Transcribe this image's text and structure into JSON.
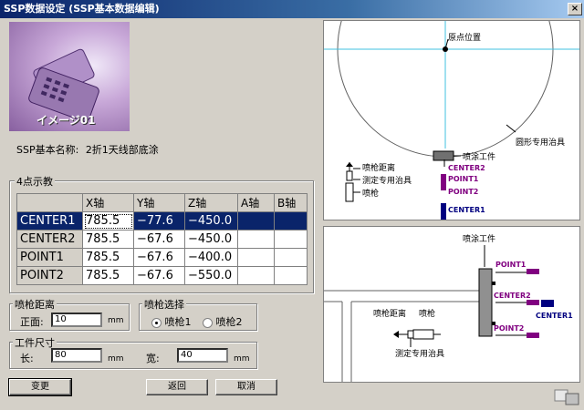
{
  "window": {
    "title": "SSP数据设定 (SSP基本数据编辑)",
    "close_glyph": "×"
  },
  "photo": {
    "label": "イメージ01"
  },
  "ssp_name": {
    "label": "SSP基本名称:",
    "value": "2折1天线部底涂"
  },
  "points_group": {
    "title": "4点示教",
    "columns": [
      "X轴",
      "Y轴",
      "Z轴",
      "A轴",
      "B轴"
    ],
    "rows": [
      {
        "name": "CENTER1",
        "x": "785.5",
        "y": "−77.6",
        "z": "−450.0",
        "a": "",
        "b": ""
      },
      {
        "name": "CENTER2",
        "x": "785.5",
        "y": "−67.6",
        "z": "−450.0",
        "a": "",
        "b": ""
      },
      {
        "name": "POINT1",
        "x": "785.5",
        "y": "−67.6",
        "z": "−400.0",
        "a": "",
        "b": ""
      },
      {
        "name": "POINT2",
        "x": "785.5",
        "y": "−67.6",
        "z": "−550.0",
        "a": "",
        "b": ""
      }
    ],
    "selected_row": "CENTER1"
  },
  "gun_distance": {
    "title": "喷枪距离",
    "label": "正面:",
    "value": "10",
    "unit": "mm"
  },
  "gun_select": {
    "title": "喷枪选择",
    "options": [
      "喷枪1",
      "喷枪2"
    ],
    "selected": "喷枪1"
  },
  "workpiece": {
    "title": "工件尺寸",
    "length_label": "长:",
    "length_value": "80",
    "length_unit": "mm",
    "width_label": "宽:",
    "width_value": "40",
    "width_unit": "mm"
  },
  "buttons": {
    "change": "变更",
    "back": "返回",
    "cancel": "取消"
  },
  "diagram_top": {
    "origin": "原点位置",
    "circle_fixture": "圆形专用治具",
    "spray_work": "喷涂工件",
    "gun_distance": "喷枪距离",
    "measure_fixture": "测定专用治具",
    "gun": "喷枪",
    "center2": "CENTER2",
    "point1": "POINT1",
    "point2": "POINT2",
    "center1": "CENTER1"
  },
  "diagram_bottom": {
    "spray_work": "喷涂工件",
    "point1": "POINT1",
    "center2": "CENTER2",
    "center1": "CENTER1",
    "point2": "POINT2",
    "gun_distance": "喷枪距离",
    "gun": "喷枪",
    "measure_fixture": "测定专用治具"
  },
  "colors": {
    "titlebar": "#0a246a",
    "selection": "#0a246a",
    "purple": "#800080",
    "navy": "#000080"
  }
}
